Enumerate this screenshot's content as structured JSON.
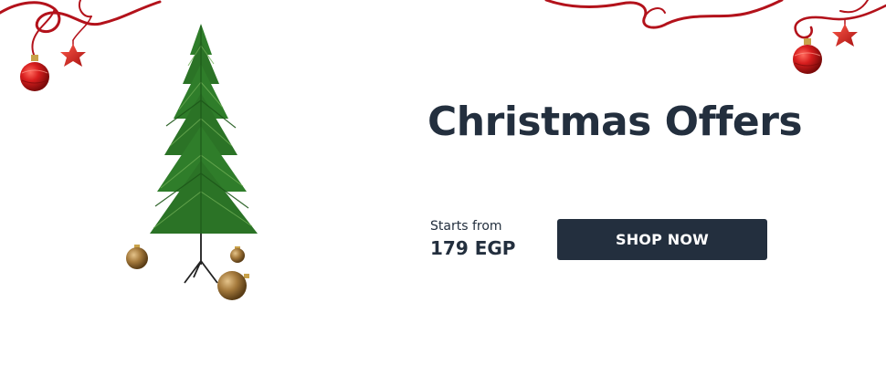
{
  "banner": {
    "headline": "Christmas Offers",
    "starts_label": "Starts from",
    "price": "179 EGP",
    "cta_label": "SHOP NOW"
  },
  "colors": {
    "text_dark": "#232f3e",
    "button_bg": "#232f3e",
    "button_text": "#ffffff",
    "ornament_red": "#d81e1e",
    "ribbon_red": "#b3121b",
    "ornament_gold": "#a57a3c",
    "tree_green": "#2f7d2a"
  },
  "icons": {
    "tree": "christmas-tree-icon",
    "ornament": "ornament-icon",
    "star": "star-ornament-icon",
    "ribbon": "ribbon-icon"
  }
}
